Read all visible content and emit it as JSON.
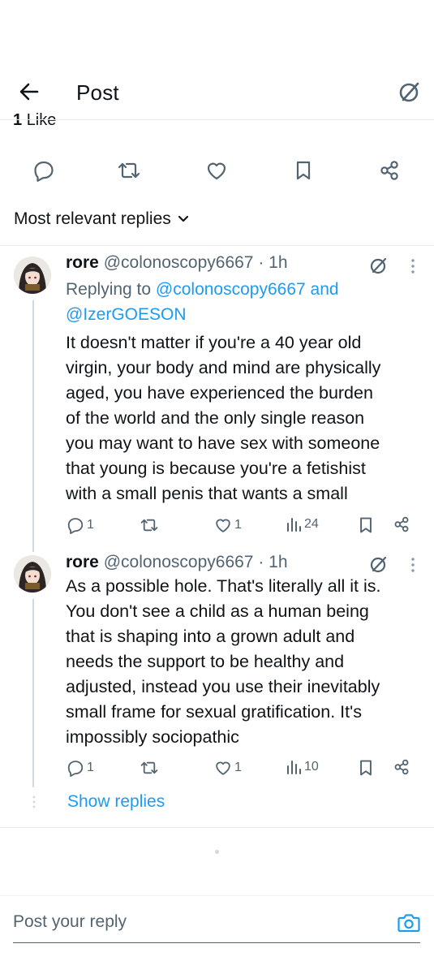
{
  "header": {
    "title": "Post"
  },
  "post_stats": {
    "likes_count": "1",
    "likes_label": "Like"
  },
  "replies_filter": {
    "label": "Most relevant replies"
  },
  "replies": [
    {
      "display_name": "rore",
      "handle": "@colonoscopy6667",
      "separator": "·",
      "time": "1h",
      "replying_prefix": "Replying to",
      "replying_user_1": "@colonoscopy6667",
      "replying_and": "and",
      "replying_user_2": "@IzerGOESON",
      "lines": [
        "It doesn't matter if you're a 40 year old",
        "virgin, your body and mind are physically",
        "aged, you have experienced the burden",
        "of the world and the only single reason",
        "you may want to have sex with someone",
        "that young is because you're a fetishist",
        "with a small penis that wants a small"
      ],
      "reply_count": "1",
      "like_count": "1",
      "view_count": "24"
    },
    {
      "display_name": "rore",
      "handle": "@colonoscopy6667",
      "separator": "·",
      "time": "1h",
      "lines": [
        "As a possible hole. That's literally all it is.",
        "You don't see a child as a human being",
        "that is shaping into a grown adult and",
        "needs the support to be healthy and",
        "adjusted, instead you use their inevitably",
        "small frame for sexual gratification. It's",
        "impossibly sociopathic"
      ],
      "reply_count": "1",
      "like_count": "1",
      "view_count": "10"
    }
  ],
  "show_replies_label": "Show replies",
  "composer": {
    "placeholder": "Post your reply"
  },
  "colors": {
    "accent": "#1d9bf0",
    "text": "#0f1419",
    "secondary": "#536471"
  }
}
